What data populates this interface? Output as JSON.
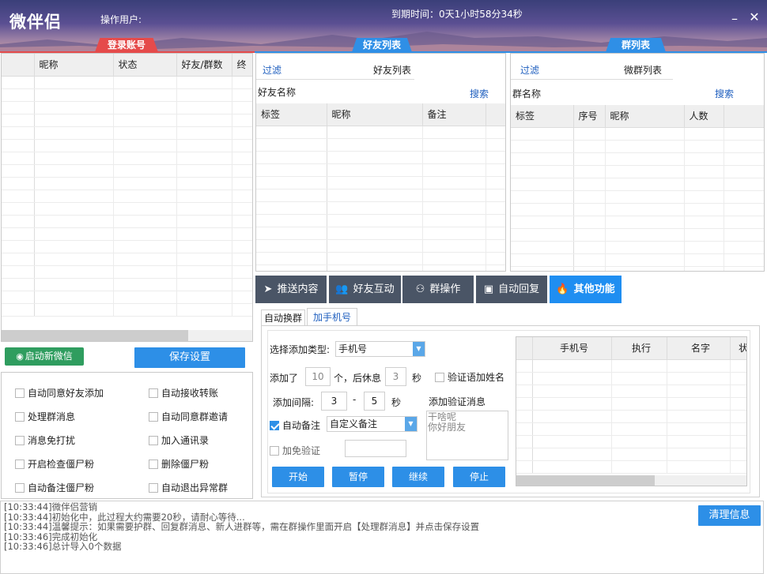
{
  "app": {
    "title": "微伴侣",
    "operator_label": "操作用户:",
    "expire_label": "到期时间：0天1小时58分34秒",
    "minimize": "–",
    "close": "✕"
  },
  "section_tabs": {
    "login": "登录账号",
    "friends": "好友列表",
    "groups": "群列表"
  },
  "accounts": {
    "columns": [
      "",
      "昵称",
      "状态",
      "好友/群数",
      "终"
    ]
  },
  "friends": {
    "filter": "过滤",
    "list_label": "好友列表",
    "name_label": "好友名称",
    "search": "搜索",
    "columns": [
      "标签",
      "昵称",
      "备注"
    ]
  },
  "groups": {
    "filter": "过滤",
    "list_label": "微群列表",
    "name_label": "群名称",
    "search": "搜索",
    "columns": [
      "标签",
      "序号",
      "昵称",
      "人数"
    ]
  },
  "actions": {
    "start_wechat": "启动新微信",
    "save_settings": "保存设置"
  },
  "options": [
    {
      "label": "自动同意好友添加",
      "checked": false
    },
    {
      "label": "自动接收转账",
      "checked": false
    },
    {
      "label": "处理群消息",
      "checked": false
    },
    {
      "label": "自动同意群邀请",
      "checked": false
    },
    {
      "label": "消息免打扰",
      "checked": false
    },
    {
      "label": "加入通讯录",
      "checked": false
    },
    {
      "label": "开启检查僵尸粉",
      "checked": false
    },
    {
      "label": "删除僵尸粉",
      "checked": false
    },
    {
      "label": "自动备注僵尸粉",
      "checked": false
    },
    {
      "label": "自动退出异常群",
      "checked": false
    }
  ],
  "func_tabs": [
    {
      "label": "推送内容",
      "icon": "send-icon",
      "active": false
    },
    {
      "label": "好友互动",
      "icon": "users-icon",
      "active": false
    },
    {
      "label": "群操作",
      "icon": "group-icon",
      "active": false
    },
    {
      "label": "自动回复",
      "icon": "robot-icon",
      "active": false
    },
    {
      "label": "其他功能",
      "icon": "flame-icon",
      "active": true
    }
  ],
  "sub_tabs": [
    "自动换群",
    "加手机号"
  ],
  "phone": {
    "type_label": "选择添加类型:",
    "type_value": "手机号",
    "added_label": "添加了",
    "added_value": "10",
    "after_rest": "个，后休息",
    "rest_value": "3",
    "sec": "秒",
    "verify_name": "验证语加姓名",
    "interval_label": "添加间隔:",
    "interval_from": "3",
    "dash": "-",
    "interval_to": "5",
    "sec2": "秒",
    "verify_msg_label": "添加验证消息",
    "verify_msg": "干啥呢\n你好朋友",
    "auto_remark": "自动备注",
    "auto_remark_checked": true,
    "remark_value": "自定义备注",
    "free_verify": "加免验证",
    "free_verify_checked": false,
    "buttons": [
      "开始",
      "暂停",
      "继续",
      "停止"
    ],
    "columns": [
      "",
      "手机号",
      "执行",
      "名字",
      "状态"
    ]
  },
  "log": {
    "clear": "清理信息",
    "lines": [
      "[10:33:44]微伴侣营销",
      "[10:33:44]初始化中，此过程大约需要20秒，请耐心等待...",
      "[10:33:44]温馨提示：如果需要护群、回复群消息、新人进群等，需在群操作里面开启【处理群消息】并点击保存设置",
      "[10:33:46]完成初始化",
      "[10:33:46]总计导入0个数据"
    ]
  },
  "colors": {
    "accent": "#2d8fe7",
    "login_tab": "#e54b4b",
    "active_func": "#1f8ef1",
    "func_bg": "#4a5566"
  }
}
